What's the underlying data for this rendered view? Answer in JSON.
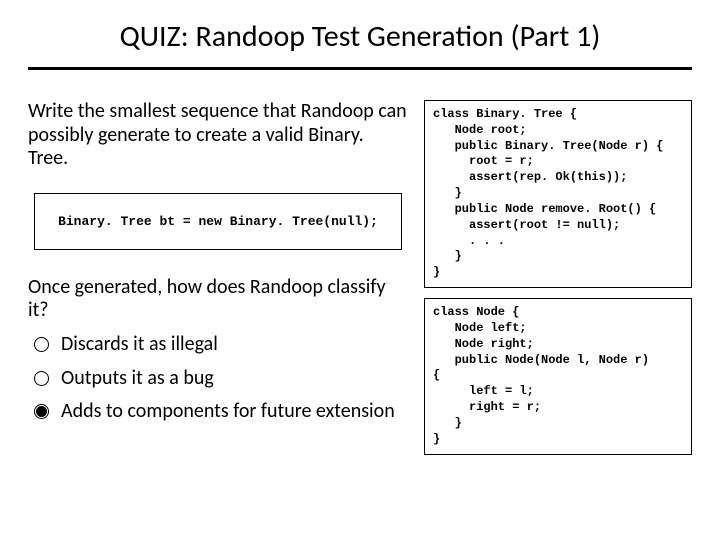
{
  "title": "QUIZ: Randoop Test Generation (Part 1)",
  "prompt": "Write the smallest sequence that Randoop can possibly generate to create a valid Binary. Tree.",
  "answer_code": "Binary. Tree bt = new Binary. Tree(null);",
  "question2": "Once generated, how does Randoop classify it?",
  "options": [
    {
      "label": "Discards it as illegal",
      "selected": false
    },
    {
      "label": "Outputs it as a bug",
      "selected": false
    },
    {
      "label": "Adds to components for future extension",
      "selected": true
    }
  ],
  "code_block_1": "class Binary. Tree {\n   Node root;\n   public Binary. Tree(Node r) {\n     root = r;\n     assert(rep. Ok(this));\n   }\n   public Node remove. Root() {\n     assert(root != null);\n     . . .\n   }\n}",
  "code_block_2": "class Node {\n   Node left;\n   Node right;\n   public Node(Node l, Node r)\n{\n     left = l;\n     right = r;\n   }\n}"
}
